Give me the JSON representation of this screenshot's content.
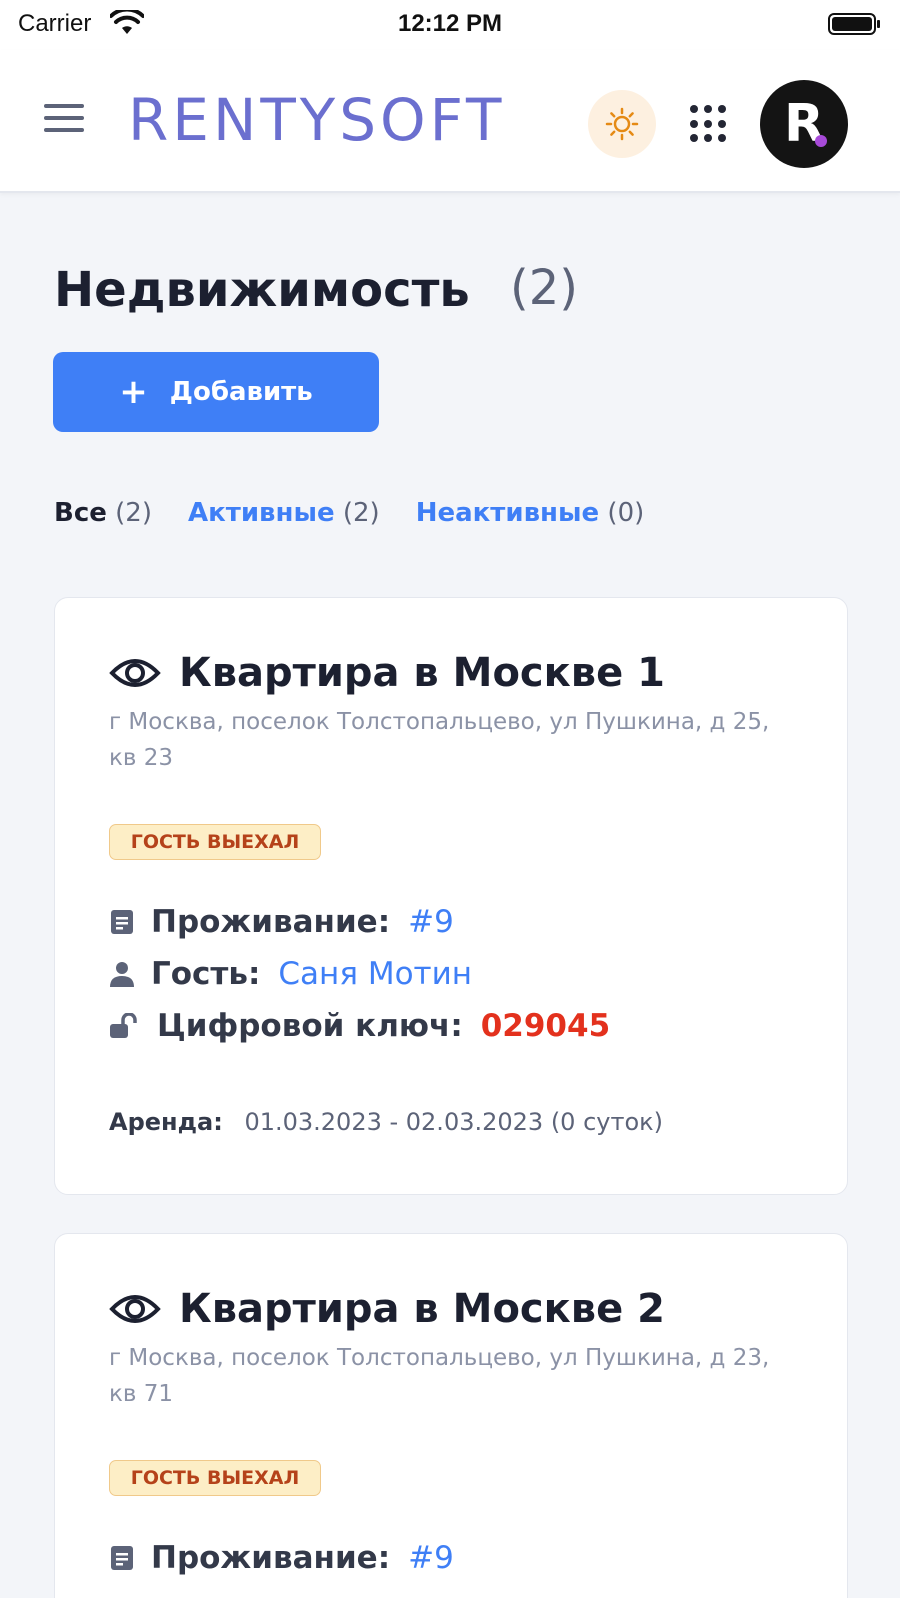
{
  "status_bar": {
    "carrier": "Carrier",
    "time": "12:12 PM"
  },
  "header": {
    "logo": "RENTYSOFT",
    "avatar_letter": "R"
  },
  "page": {
    "title": "Недвижимость",
    "count": "(2)",
    "add_button": "Добавить"
  },
  "filters": [
    {
      "label": "Все",
      "count": "(2)"
    },
    {
      "label": "Активные",
      "count": "(2)"
    },
    {
      "label": "Неактивные",
      "count": "(0)"
    }
  ],
  "properties": [
    {
      "title": "Квартира в Москве 1",
      "address": "г Москва, поселок Толстопальцево, ул Пушкина, д 25, кв 23",
      "status": "ГОСТЬ ВЫЕХАЛ",
      "stay_label": "Проживание:",
      "stay_value": "#9",
      "guest_label": "Гость:",
      "guest_value": "Саня Мотин",
      "key_label": "Цифровой ключ:",
      "key_value": "029045",
      "rent_label": "Аренда:",
      "rent_value": "01.03.2023 - 02.03.2023 (0 суток)"
    },
    {
      "title": "Квартира в Москве 2",
      "address": "г Москва, поселок Толстопальцево, ул Пушкина, д 23, кв 71",
      "status": "ГОСТЬ ВЫЕХАЛ",
      "stay_label": "Проживание:",
      "stay_value": "#9"
    }
  ],
  "colors": {
    "accent": "#3f7ff6",
    "logo": "#6b6fcf",
    "key": "#e3311d",
    "badge_bg": "#fdeec6",
    "badge_text": "#b5421a"
  },
  "icons": [
    "wifi-icon",
    "battery-icon",
    "menu-icon",
    "sun-icon",
    "apps-grid-icon",
    "eye-icon",
    "document-icon",
    "user-icon",
    "unlock-icon",
    "plus-icon"
  ]
}
